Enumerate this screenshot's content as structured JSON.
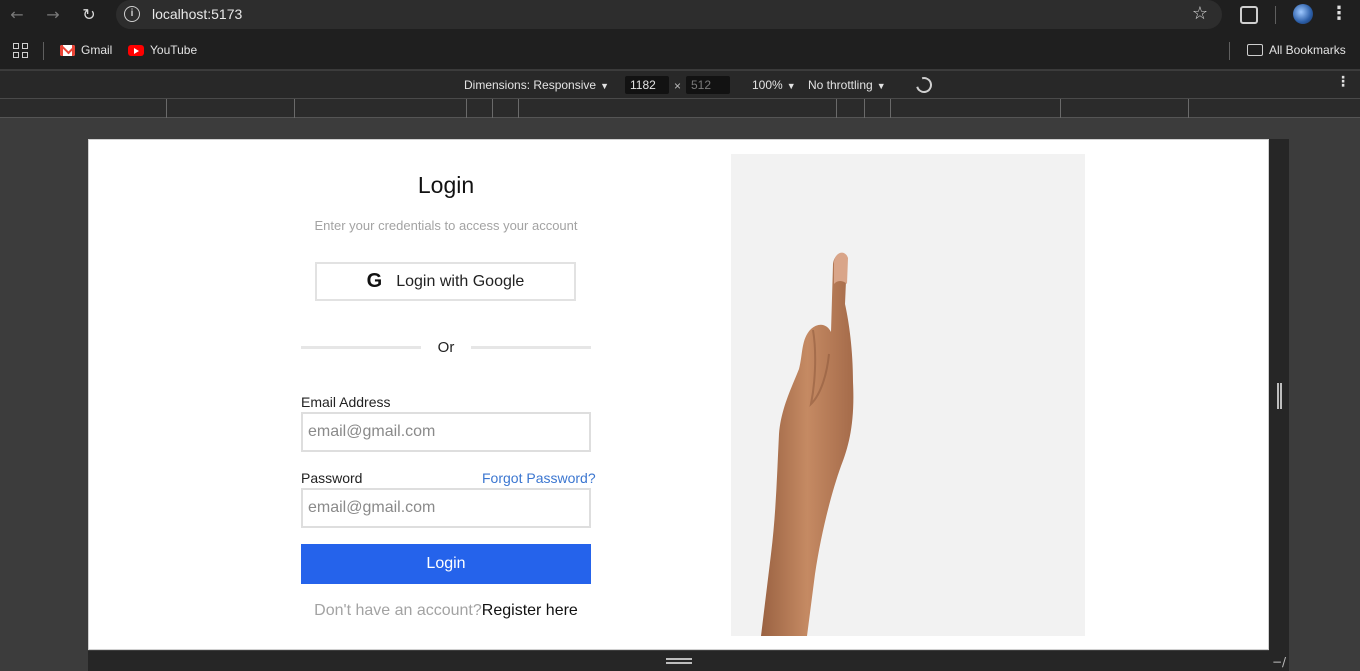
{
  "browser": {
    "url": "localhost:5173",
    "bookmarks": [
      {
        "label": "Gmail",
        "icon": "gmail-icon"
      },
      {
        "label": "YouTube",
        "icon": "youtube-icon"
      }
    ],
    "all_bookmarks_label": "All Bookmarks"
  },
  "devtools": {
    "dimensions_label": "Dimensions: Responsive",
    "width_value": "1182",
    "times": "×",
    "height_value": "512",
    "zoom": "100%",
    "throttling": "No throttling"
  },
  "login": {
    "title": "Login",
    "subtitle": "Enter your credentials to access your account",
    "google_button": "Login with Google",
    "google_glyph": "G",
    "divider": "Or",
    "email_label": "Email Address",
    "email_placeholder": "email@gmail.com",
    "password_label": "Password",
    "forgot_password": "Forgot Password?",
    "password_placeholder": "email@gmail.com",
    "submit": "Login",
    "no_account": "Don't have an account?",
    "register": "Register here"
  },
  "colors": {
    "primary": "#2563eb",
    "link": "#3b76d0",
    "muted": "#a3a3a3",
    "hero_bg": "#f2f2f2"
  }
}
